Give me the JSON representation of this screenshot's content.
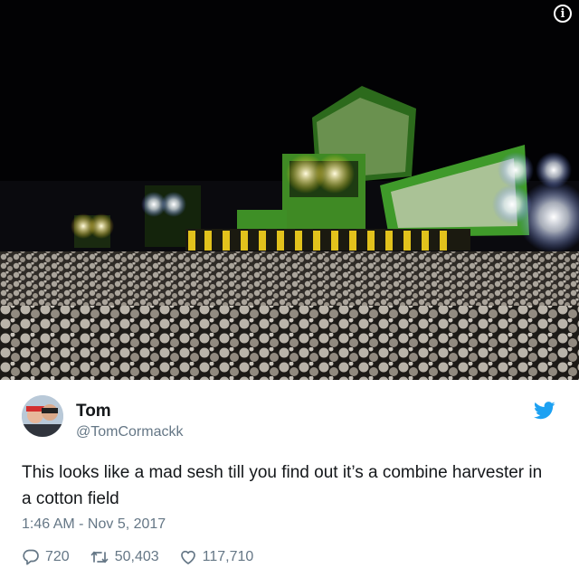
{
  "tweet": {
    "name": "Tom",
    "handle": "@TomCormackk",
    "text": "This looks like a mad sesh till you find out it’s a combine harvester in a cotton field",
    "timestamp": "1:46 AM - Nov 5, 2017",
    "replies": "720",
    "retweets": "50,403",
    "likes": "117,710"
  },
  "icons": {
    "info": "info-icon",
    "bird": "twitter-bird-icon",
    "reply": "reply-icon",
    "retweet": "retweet-icon",
    "like": "heart-icon"
  },
  "colors": {
    "twitter_blue": "#1da1f2",
    "text": "#14171a",
    "muted": "#657786"
  }
}
